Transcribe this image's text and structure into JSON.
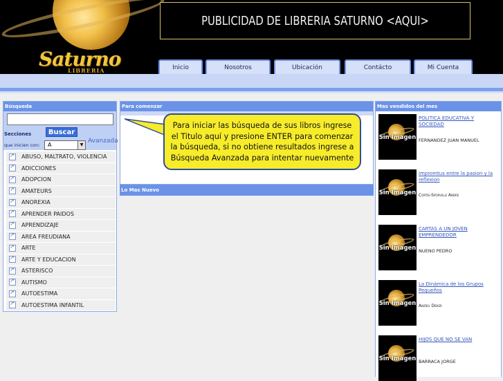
{
  "header": {
    "logo_text": "Saturno",
    "logo_subtext": "LIBRERIA",
    "ad_banner": "PUBLICIDAD DE LIBRERIA SATURNO <AQUI>"
  },
  "nav": {
    "tabs": [
      {
        "label": "Inicio"
      },
      {
        "label": "Nosotros"
      },
      {
        "label": "Ubicación"
      },
      {
        "label": "Contácto"
      },
      {
        "label": "Mi Cuenta"
      }
    ]
  },
  "search": {
    "title": "Búsqueda",
    "input_value": "",
    "button_label": "Buscar",
    "sections_label": "Secciones",
    "initial_label": "que inicien con:",
    "initial_value": "A",
    "advanced_label": "Avanzada"
  },
  "sections": [
    "ABUSO, MALTRATO, VIOLENCIA",
    "ADICCIONES",
    "ADOPCION",
    "AMATEURS",
    "ANOREXIA",
    "APRENDER PAIDOS",
    "APRENDIZAJE",
    "AREA FREUDIANA",
    "ARTE",
    "ARTE Y EDUCACION",
    "ASTERISCO",
    "AUTISMO",
    "AUTOESTIMA",
    "AUTOESTIMA INFANTIL"
  ],
  "center": {
    "title": "Para comenzar",
    "callout": "Para iniciar las búsqueda de sus libros ingrese el Titulo aquí y presione ENTER para comenzar la búsqueda, si no obtiene resultados ingrese a Búsqueda Avanzada para intentar nuevamente",
    "new_title": "Lo Mas Nuevo"
  },
  "bestsellers": {
    "title": "Mas vendidos del mes",
    "cover_text": "Sin Imagen",
    "books": [
      {
        "title": "POLITICA EDUCATIVA Y SOCIEDAD",
        "author": "FERNANDEZ JUAN MANUEL",
        "small_caps": false
      },
      {
        "title": "impromtus entre la pasion y la reflexion",
        "author": "Cortie-Sporville Andre",
        "small_caps": true
      },
      {
        "title": "CARTAS A UN JOVEN EMPRENDEDOR",
        "author": "NUENO PEDRO",
        "small_caps": false
      },
      {
        "title": "La Dinámica de los Grupos Pequeños",
        "author": "Anzieu Didier",
        "small_caps": true
      },
      {
        "title": "HIJOS QUE NO SE VAN",
        "author": "BARRACA JORGE",
        "small_caps": false
      }
    ]
  }
}
